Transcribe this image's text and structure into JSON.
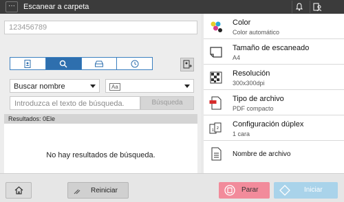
{
  "header": {
    "menu_label": "···",
    "title": "Escanear a carpeta"
  },
  "left": {
    "address_value": "123456789",
    "search_type": "Buscar nombre",
    "text_type_badge": "Aa",
    "search_placeholder": "Introduzca el texto de búsqueda.",
    "search_button": "Búsqueda",
    "results_label": "Resultados: 0Ele",
    "no_results": "No hay resultados de búsqueda."
  },
  "settings": [
    {
      "label": "Color",
      "value": "Color automático"
    },
    {
      "label": "Tamaño de escaneado",
      "value": "A4"
    },
    {
      "label": "Resolución",
      "value": "300x300dpi"
    },
    {
      "label": "Tipo de archivo",
      "value": "PDF compacto"
    },
    {
      "label": "Configuración dúplex",
      "value": "1 cara"
    },
    {
      "label": "Nombre de archivo",
      "value": ""
    }
  ],
  "bottom": {
    "reset": "Reiniciar",
    "stop": "Parar",
    "start": "Iniciar"
  },
  "icons": [
    "menu-icon",
    "bell-icon",
    "user-status-icon",
    "address-book-icon",
    "search-icon",
    "tray-icon",
    "history-icon",
    "add-destination-icon",
    "color-icon",
    "paper-size-icon",
    "resolution-icon",
    "pdf-icon",
    "duplex-icon",
    "document-icon",
    "home-icon",
    "reset-icon",
    "stop-icon",
    "start-icon"
  ],
  "colors": {
    "accent": "#2e6fae",
    "stop": "#f28b9b",
    "start": "#a9d3ea",
    "topbar": "#3b3b3b"
  }
}
